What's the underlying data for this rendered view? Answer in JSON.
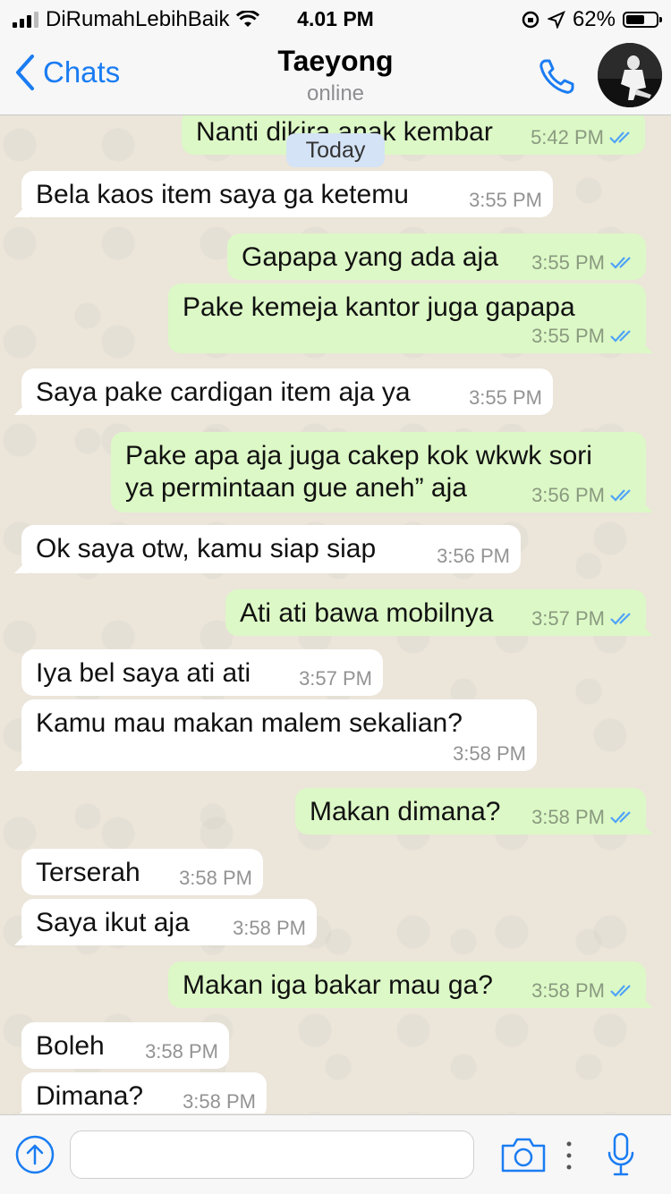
{
  "status_bar": {
    "carrier": "DiRumahLebihBaik",
    "time": "4.01 PM",
    "battery": "62%",
    "battery_level": 0.62
  },
  "header": {
    "back_label": "Chats",
    "contact_name": "Taeyong",
    "status": "online",
    "icons": [
      "chevron-left-icon",
      "phone-icon",
      "avatar"
    ]
  },
  "chat": {
    "date_divider": "Today",
    "messages": [
      {
        "dir": "out",
        "text": "Nanti dikira anak kembar",
        "time": "5:42 PM"
      },
      {
        "dir": "in",
        "text": "Bela kaos item saya ga ketemu",
        "time": "3:55 PM"
      },
      {
        "dir": "out",
        "text": "Gapapa yang ada aja",
        "time": "3:55 PM"
      },
      {
        "dir": "out",
        "text": "Pake kemeja kantor juga gapapa",
        "time": "3:55 PM"
      },
      {
        "dir": "in",
        "text": "Saya pake cardigan item aja ya",
        "time": "3:55 PM"
      },
      {
        "dir": "out",
        "text1": "Pake apa aja juga cakep kok wkwk sori",
        "text2": "ya permintaan gue aneh” aja",
        "time": "3:56 PM"
      },
      {
        "dir": "in",
        "text": "Ok saya otw, kamu siap siap",
        "time": "3:56 PM"
      },
      {
        "dir": "out",
        "text": "Ati ati bawa mobilnya",
        "time": "3:57 PM"
      },
      {
        "dir": "in",
        "text": "Iya bel saya ati ati",
        "time": "3:57 PM"
      },
      {
        "dir": "in",
        "text": "Kamu mau makan malem sekalian?",
        "time": "3:58 PM"
      },
      {
        "dir": "out",
        "text": "Makan dimana?",
        "time": "3:58 PM"
      },
      {
        "dir": "in",
        "text": "Terserah",
        "time": "3:58 PM"
      },
      {
        "dir": "in",
        "text": "Saya ikut aja",
        "time": "3:58 PM"
      },
      {
        "dir": "out",
        "text": "Makan iga bakar mau ga?",
        "time": "3:58 PM"
      },
      {
        "dir": "in",
        "text": "Boleh",
        "time": "3:58 PM"
      },
      {
        "dir": "in",
        "text": "Dimana?",
        "time": "3:58 PM"
      }
    ]
  },
  "input_bar": {
    "placeholder": "",
    "icons": [
      "upload-icon",
      "camera-icon",
      "more-dots-icon",
      "microphone-icon"
    ]
  },
  "colors": {
    "accent": "#1a7cf2",
    "outgoing_bubble": "#dcf8c6",
    "incoming_bubble": "#ffffff",
    "read_ticks": "#4fa3f7"
  }
}
